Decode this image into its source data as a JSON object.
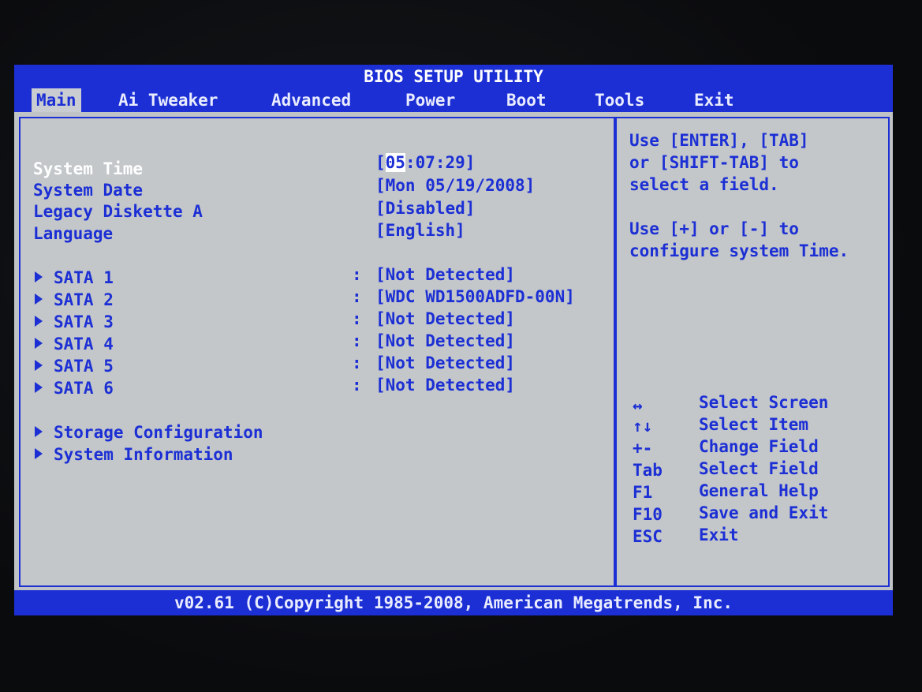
{
  "title": "BIOS SETUP UTILITY",
  "menu": [
    "Main",
    "Ai Tweaker",
    "Advanced",
    "Power",
    "Boot",
    "Tools",
    "Exit"
  ],
  "settings": [
    {
      "label": "System Time",
      "value_pre": "[",
      "value_hl": "05",
      "value_post": ":07:29]"
    },
    {
      "label": "System Date",
      "value": "[Mon 05/19/2008]"
    },
    {
      "label": "Legacy Diskette A",
      "value": "[Disabled]"
    },
    {
      "label": "Language",
      "value": "[English]"
    }
  ],
  "sata": [
    {
      "label": "SATA 1",
      "value": "[Not Detected]"
    },
    {
      "label": "SATA 2",
      "value": "[WDC WD1500ADFD-00N]"
    },
    {
      "label": "SATA 3",
      "value": "[Not Detected]"
    },
    {
      "label": "SATA 4",
      "value": "[Not Detected]"
    },
    {
      "label": "SATA 5",
      "value": "[Not Detected]"
    },
    {
      "label": "SATA 6",
      "value": "[Not Detected]"
    }
  ],
  "submenus": [
    "Storage Configuration",
    "System Information"
  ],
  "help": {
    "line1": "Use [ENTER], [TAB]",
    "line2": "or [SHIFT-TAB] to",
    "line3": "select a field.",
    "line4": "Use [+] or [-] to",
    "line5": "configure system Time."
  },
  "keys": [
    {
      "key": "↔",
      "desc": "Select Screen"
    },
    {
      "key": "↑↓",
      "desc": "Select Item"
    },
    {
      "key": "+-",
      "desc": "Change Field"
    },
    {
      "key": "Tab",
      "desc": "Select Field"
    },
    {
      "key": "F1",
      "desc": "General Help"
    },
    {
      "key": "F10",
      "desc": "Save and Exit"
    },
    {
      "key": "ESC",
      "desc": "Exit"
    }
  ],
  "footer": "v02.61 (C)Copyright 1985-2008, American Megatrends, Inc.",
  "colors": {
    "accent": "#1c2fd4",
    "background": "#c3c7ca",
    "selected_text": "#ffffff"
  }
}
